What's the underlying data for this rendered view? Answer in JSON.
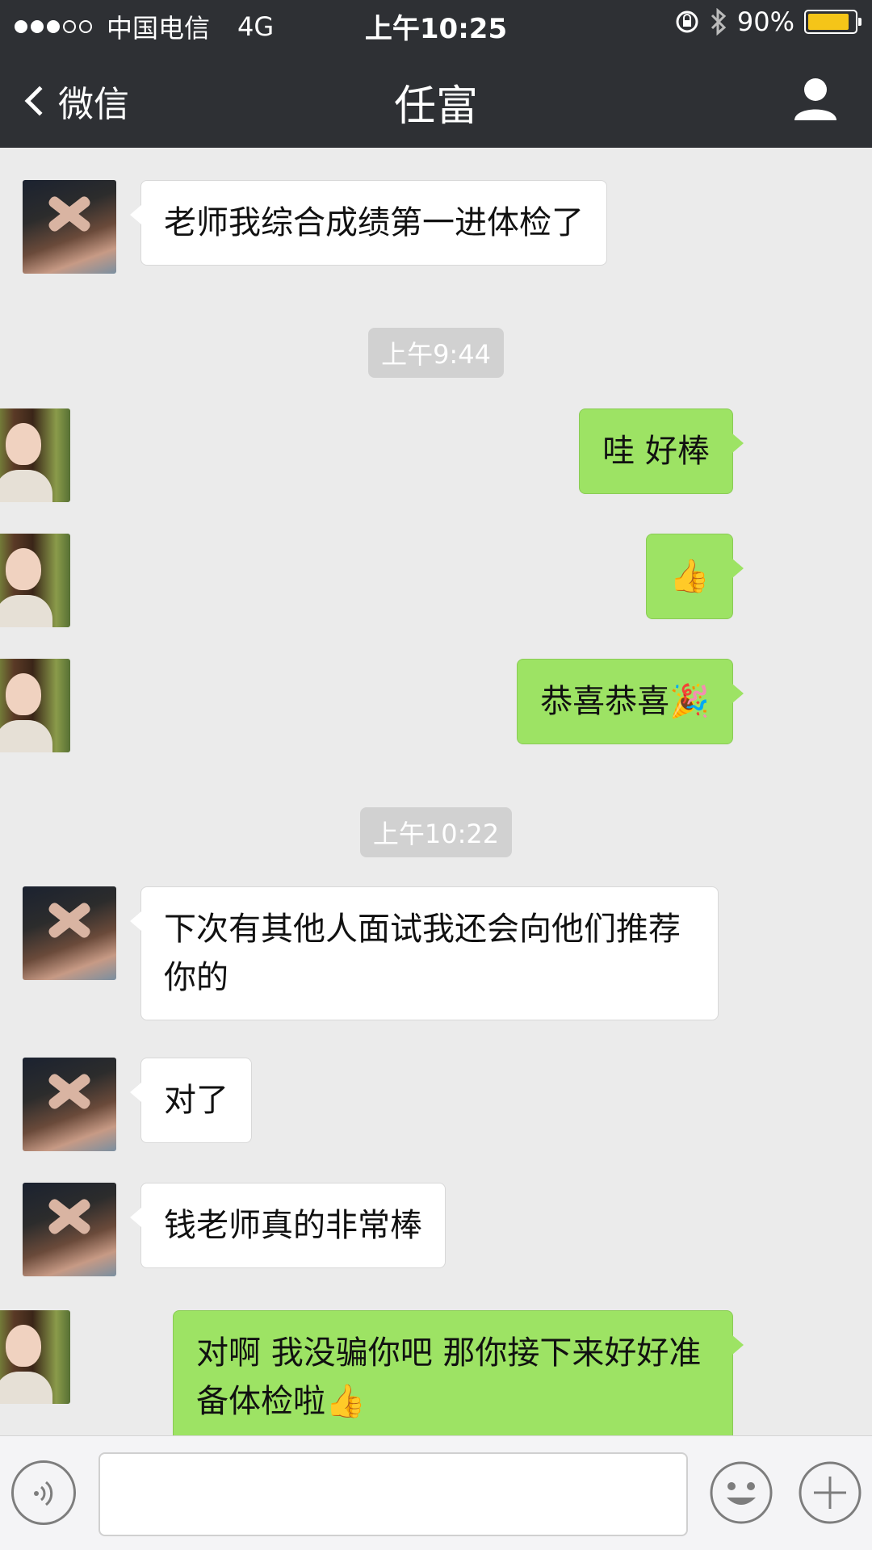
{
  "status_bar": {
    "carrier": "中国电信",
    "network": "4G",
    "time": "上午10:25",
    "battery": "90%",
    "battery_level": 0.9
  },
  "nav": {
    "back_label": "微信",
    "title": "任富"
  },
  "messages": [
    {
      "side": "in",
      "text": "老师我综合成绩第一进体检了"
    },
    {
      "type": "time",
      "text": "上午9:44"
    },
    {
      "side": "out",
      "text": "哇 好棒"
    },
    {
      "side": "out",
      "text": "👍"
    },
    {
      "side": "out",
      "text": "恭喜恭喜🎉"
    },
    {
      "type": "time",
      "text": "上午10:22"
    },
    {
      "side": "in",
      "text": "下次有其他人面试我还会向他们推荐你的"
    },
    {
      "side": "in",
      "text": "对了"
    },
    {
      "side": "in",
      "text": "钱老师真的非常棒"
    },
    {
      "side": "out",
      "text": "对啊 我没骗你吧 那你接下来好好准备体检啦👍"
    }
  ],
  "input": {
    "value": ""
  },
  "icons": {
    "voice": "voice-icon",
    "emoji": "smiley-icon",
    "more": "plus-icon",
    "profile": "person-icon",
    "bluetooth": "bluetooth-icon",
    "lock_rotation": "rotation-lock-icon"
  }
}
